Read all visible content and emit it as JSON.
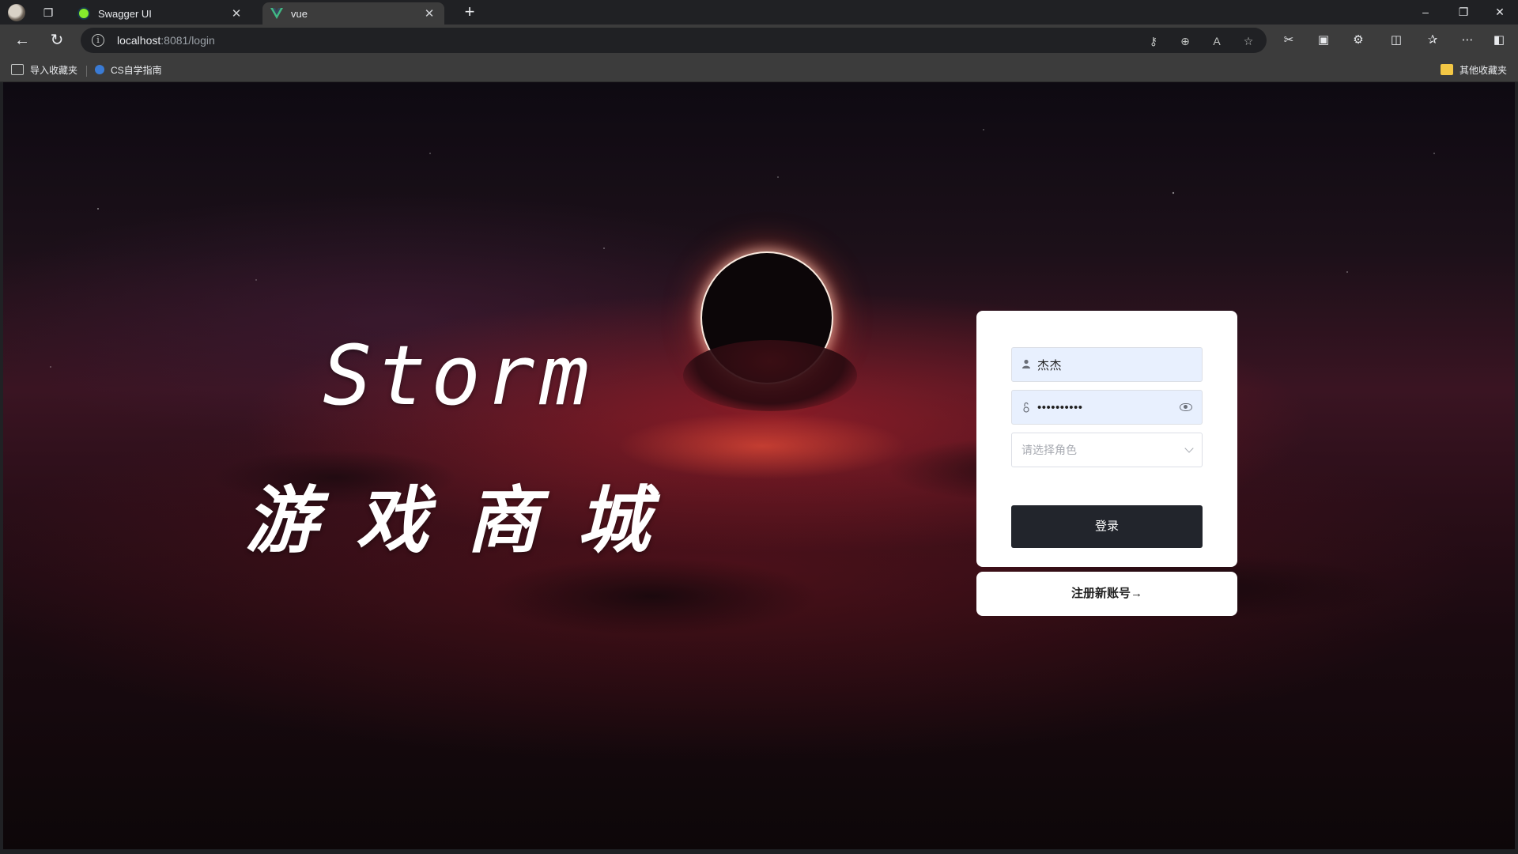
{
  "browser": {
    "tabs": [
      {
        "title": "Swagger UI",
        "active": false
      },
      {
        "title": "vue",
        "active": true
      }
    ],
    "address": {
      "host": "localhost",
      "rest": ":8081/login"
    },
    "bookmarks": [
      {
        "label": "导入收藏夹"
      },
      {
        "label": "CS自学指南"
      }
    ],
    "other_bookmarks": "其他收藏夹",
    "accent": "#3c3c3c"
  },
  "hero": {
    "title": "Storm",
    "subtitle": "游戏商城"
  },
  "login": {
    "username_value": "杰杰",
    "password_value": "••••••••••",
    "role_placeholder": "请选择角色",
    "login_label": "登录",
    "register_label": "注册新账号→",
    "button_color": "#22252c",
    "autofill_color": "#e8f0fe"
  }
}
